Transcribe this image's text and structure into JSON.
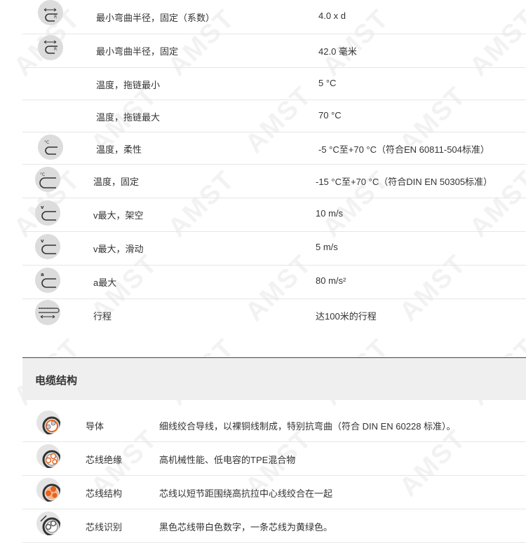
{
  "properties": [
    {
      "label": "最小弯曲半径，固定（系数）",
      "value": "4.0 x d",
      "icon": "bend-radius-icon"
    },
    {
      "label": "最小弯曲半径，固定",
      "value": "42.0 毫米",
      "icon": "bend-radius-icon"
    },
    {
      "label": "温度，拖链最小",
      "value": "5 °C",
      "icon": ""
    },
    {
      "label": "温度，拖链最大",
      "value": "70 °C",
      "icon": ""
    },
    {
      "label": "温度，柔性",
      "value": "-5 °C至+70 °C（符合EN 60811-504标准）",
      "icon": "temperature-flex-icon"
    },
    {
      "label": "温度，固定",
      "value": "-15 °C至+70 °C（符合DIN EN 50305标准）",
      "icon": "temperature-fixed-icon"
    },
    {
      "label": "v最大，架空",
      "value": "10 m/s",
      "icon": "velocity-icon"
    },
    {
      "label": "v最大，滑动",
      "value": "5 m/s",
      "icon": "velocity-icon"
    },
    {
      "label": "a最大",
      "value": "80 m/s²",
      "icon": "acceleration-icon"
    },
    {
      "label": "行程",
      "value": "达100米的行程",
      "icon": "travel-icon"
    }
  ],
  "cable_structure": {
    "title": "电缆结构",
    "items": [
      {
        "label": "导体",
        "value": "细线绞合导线，以裸铜线制成，特别抗弯曲（符合 DIN EN 60228 标准）。",
        "icon": "conductor-icon"
      },
      {
        "label": "芯线绝缘",
        "value": "高机械性能、低电容的TPE混合物",
        "icon": "core-insulation-icon"
      },
      {
        "label": "芯线结构",
        "value": "芯线以短节距围绕高抗拉中心线绞合在一起",
        "icon": "core-structure-icon"
      },
      {
        "label": "芯线识别",
        "value": "黑色芯线带白色数字，一条芯线为黄绿色。",
        "icon": "core-identification-icon"
      }
    ]
  },
  "watermark": "AMST",
  "colors": {
    "accent": "#e8641b",
    "icon_bg": "#dcdcdc",
    "divider": "#e6e6e6"
  }
}
